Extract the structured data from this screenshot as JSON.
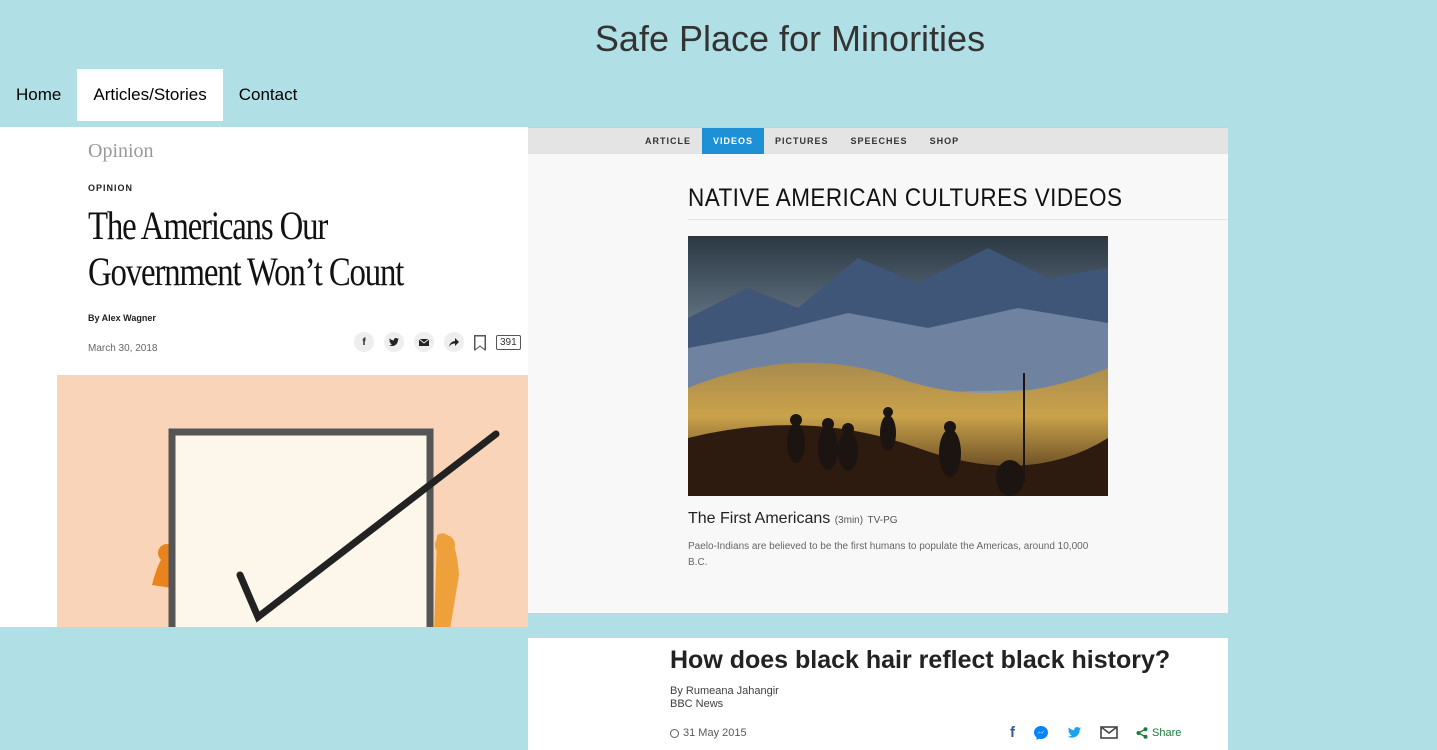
{
  "site": {
    "title": "Safe Place for Minorities"
  },
  "nav": {
    "items": [
      "Home",
      "Articles/Stories",
      "Contact"
    ],
    "active": "Articles/Stories"
  },
  "nyt": {
    "section": "Opinion",
    "kicker": "OPINION",
    "headline": "The Americans Our Government Won’t Count",
    "byline": "By Alex Wagner",
    "date": "March 30, 2018",
    "comment_count": "391",
    "share_icons": [
      "facebook-icon",
      "twitter-icon",
      "email-icon",
      "share-arrow-icon",
      "bookmark-icon",
      "comments-icon"
    ]
  },
  "history": {
    "tabs": [
      "ARTICLE",
      "VIDEOS",
      "PICTURES",
      "SPEECHES",
      "SHOP"
    ],
    "active_tab": "VIDEOS",
    "accent": "#1e90d6",
    "page_heading": "NATIVE AMERICAN CULTURES VIDEOS",
    "video": {
      "title": "The First Americans",
      "duration": "(3min)",
      "rating": "TV-PG",
      "description": "Paelo-Indians are believed to be the first humans to populate the Americas, around 10,000 B.C."
    }
  },
  "bbc": {
    "headline": "How does black hair reflect black history?",
    "author": "By Rumeana Jahangir",
    "org": "BBC News",
    "date": "31 May 2015",
    "share_label": "Share",
    "share_icons": [
      "facebook-icon",
      "messenger-icon",
      "twitter-icon",
      "email-icon",
      "share-icon"
    ]
  },
  "colors": {
    "page_background": "#b0e0e6",
    "nyt_art_background": "#f9d4b9"
  }
}
